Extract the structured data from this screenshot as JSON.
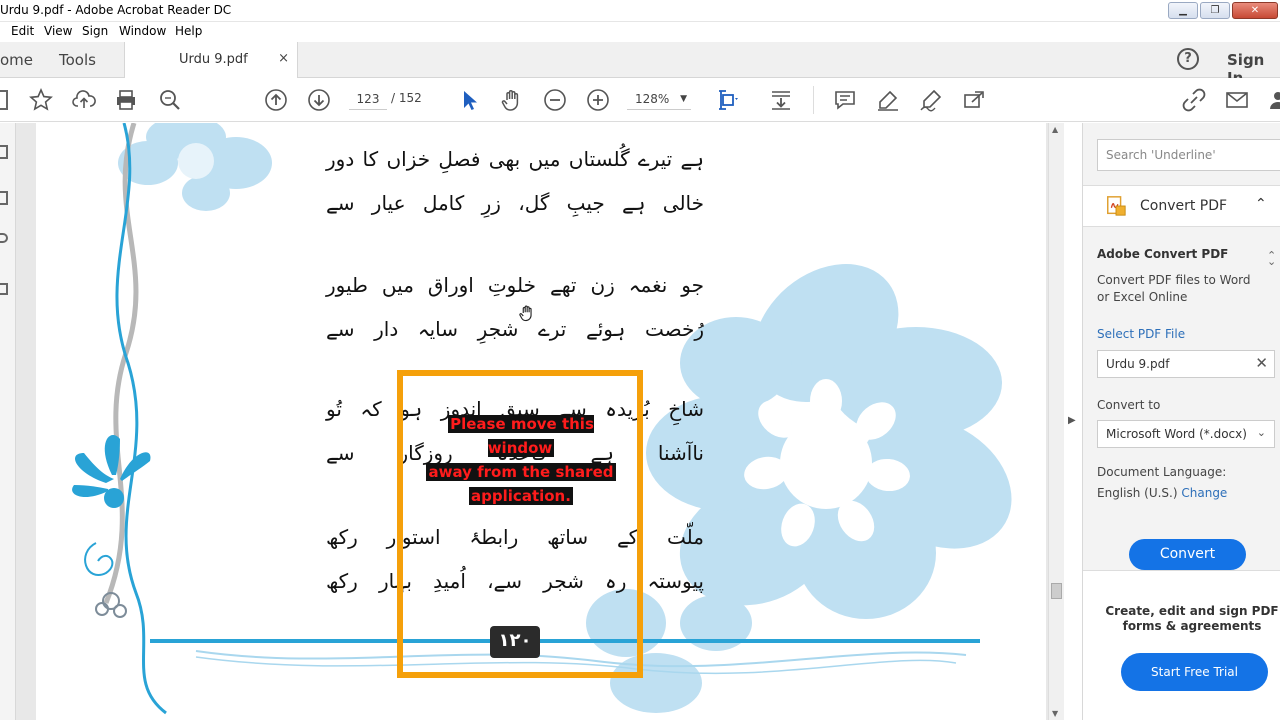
{
  "window": {
    "title": "Urdu 9.pdf - Adobe Acrobat Reader DC",
    "minimize": "▁",
    "restore": "❐",
    "close": "✕"
  },
  "menu": {
    "edit": "Edit",
    "view": "View",
    "sign": "Sign",
    "window": "Window",
    "help": "Help"
  },
  "tabs": {
    "home": "ome",
    "tools": "Tools",
    "document": "Urdu 9.pdf",
    "close": "×",
    "help": "?",
    "sign_in": "Sign In"
  },
  "toolbar": {
    "page_current": "123",
    "page_total": "/ 152",
    "zoom": "128%",
    "zoom_dropdown": "▼"
  },
  "icons": [
    "star-icon",
    "upload-icon",
    "print-icon",
    "zoom-search-icon",
    "page-up-icon",
    "page-down-icon",
    "select-cursor-icon",
    "hand-icon",
    "zoom-out-icon",
    "zoom-in-icon",
    "fit-page-icon",
    "scroll-mode-icon",
    "comment-icon",
    "highlight-icon",
    "sign-icon",
    "fill-sign-icon",
    "share-link-icon",
    "email-icon",
    "user-icon"
  ],
  "document": {
    "stanzas": [
      {
        "lines": [
          "ہے تیرے گُلستاں میں بھی فصلِ خزاں کا دور",
          "خالی ہے جیبِ گل، زرِ کامل عیار سے"
        ]
      },
      {
        "lines": [
          "جو نغمہ زن تھے خلوتِ اوراق میں طیور",
          "رُخصت ہوئے ترے شجرِ سایہ دار سے"
        ]
      },
      {
        "lines": [
          "شاخِ بُریدہ سے سبق اندوز ہو کہ تُو",
          "ناآشنا ہے قاعدۂ روزگار سے"
        ]
      },
      {
        "lines": [
          "ملّت کے ساتھ رابطۂ استوار رکھ",
          "پیوستہ رہ شجر سے، اُمیدِ بہار رکھ"
        ]
      }
    ],
    "page_number": "۱۲۰"
  },
  "overlay": {
    "message_lines": [
      "Please move this window",
      "away from the shared",
      "application."
    ]
  },
  "panel": {
    "search_placeholder": "Search 'Underline'",
    "convert_title": "Convert PDF",
    "section_title": "Adobe Convert PDF",
    "description_1": "Convert PDF files to Word",
    "description_2": "or Excel Online",
    "select_file": "Select PDF File",
    "file_name": "Urdu 9.pdf",
    "convert_to_label": "Convert to",
    "convert_to_value": "Microsoft Word (*.docx)",
    "language_label": "Document Language:",
    "language_value": "English (U.S.)",
    "change_link": "Change",
    "convert_button": "Convert",
    "promo_1": "Create, edit and sign PDF",
    "promo_2": "forms & agreements",
    "trial_button": "Start Free Trial"
  },
  "colors": {
    "accent": "#1473e6",
    "share_frame": "#f5a00a",
    "overlay_text": "#ff1c1c",
    "flower": "#bfe0f2",
    "vine": "#29a3d6"
  }
}
